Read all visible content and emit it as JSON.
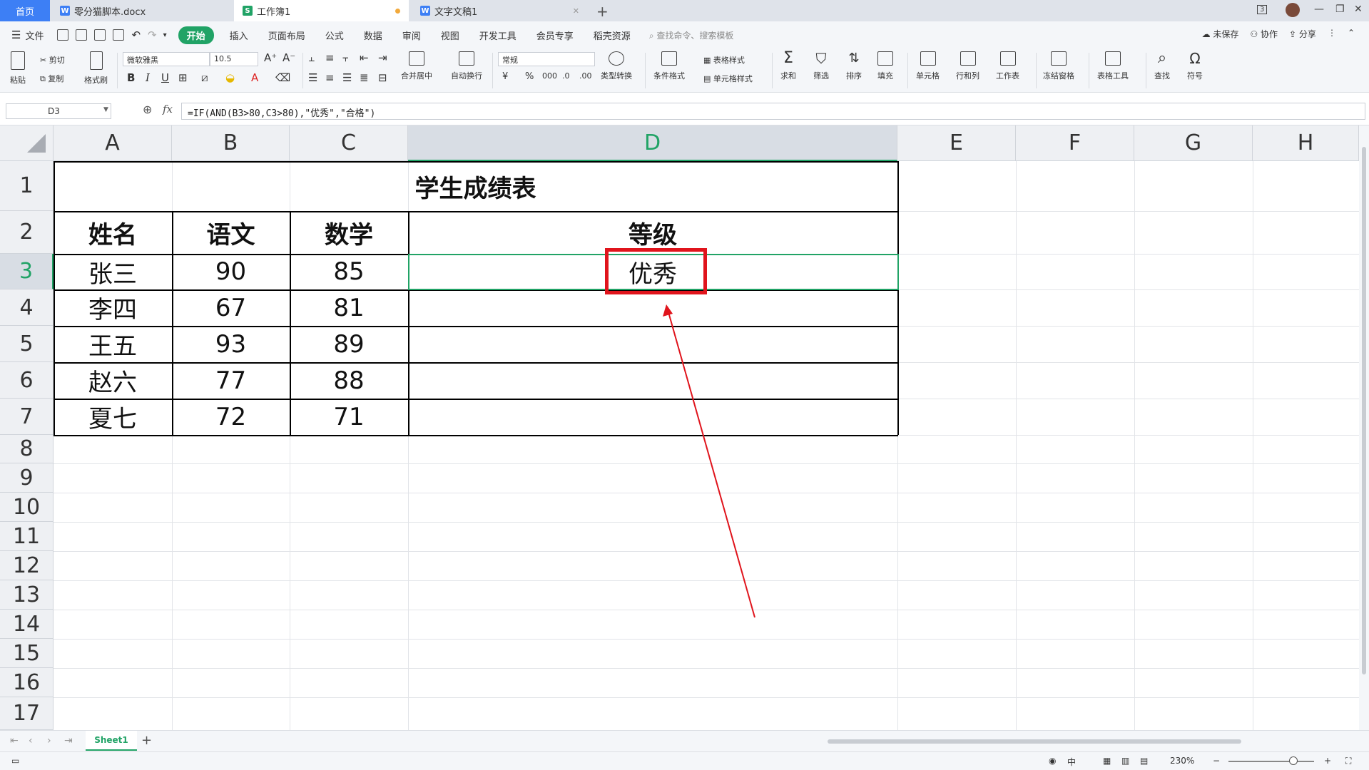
{
  "tabs": {
    "home": "首页",
    "doc1": "零分猫脚本.docx",
    "book": "工作簿1",
    "doc2": "文字文稿1"
  },
  "window_badge": "3",
  "menu": {
    "file": "文件",
    "items": [
      "开始",
      "插入",
      "页面布局",
      "公式",
      "数据",
      "审阅",
      "视图",
      "开发工具",
      "会员专享",
      "稻壳资源"
    ],
    "search": "查找命令、搜索模板",
    "unsaved": "未保存",
    "collab": "协作",
    "share": "分享"
  },
  "ribbon": {
    "paste": "粘贴",
    "cut": "剪切",
    "copy": "复制",
    "format_painter": "格式刷",
    "font_name": "微软雅黑",
    "font_size": "10.5",
    "merge_center": "合并居中",
    "wrap_text": "自动换行",
    "number_format": "常规",
    "type_convert": "类型转换",
    "cond_format": "条件格式",
    "table_style": "表格样式",
    "cell_style": "单元格样式",
    "sum": "求和",
    "filter": "筛选",
    "sort": "排序",
    "fill": "填充",
    "cell": "单元格",
    "row_col": "行和列",
    "worksheet": "工作表",
    "freeze": "冻结窗格",
    "table_tools": "表格工具",
    "find": "查找",
    "symbol": "符号"
  },
  "formula_bar": {
    "name_box": "D3",
    "formula": "=IF(AND(B3>80,C3>80),\"优秀\",\"合格\")"
  },
  "grid": {
    "columns": [
      "A",
      "B",
      "C",
      "D",
      "E",
      "F",
      "G",
      "H"
    ],
    "rows": [
      "1",
      "2",
      "3",
      "4",
      "5",
      "6",
      "7",
      "8",
      "9",
      "10",
      "11",
      "12",
      "13",
      "14",
      "15",
      "16",
      "17"
    ],
    "selected_column": "D",
    "selected_row": "3",
    "title": "学生成绩表",
    "headers": [
      "姓名",
      "语文",
      "数学",
      "等级"
    ],
    "records": [
      [
        "张三",
        "90",
        "85",
        "优秀"
      ],
      [
        "李四",
        "67",
        "81",
        ""
      ],
      [
        "王五",
        "93",
        "89",
        ""
      ],
      [
        "赵六",
        "77",
        "88",
        ""
      ],
      [
        "夏七",
        "72",
        "71",
        ""
      ]
    ]
  },
  "sheets": [
    "Sheet1"
  ],
  "status": {
    "zoom": "230%"
  },
  "colors": {
    "accent_green": "#21a366",
    "highlight_red": "#e0141c",
    "tab_blue": "#3d7ff5"
  }
}
